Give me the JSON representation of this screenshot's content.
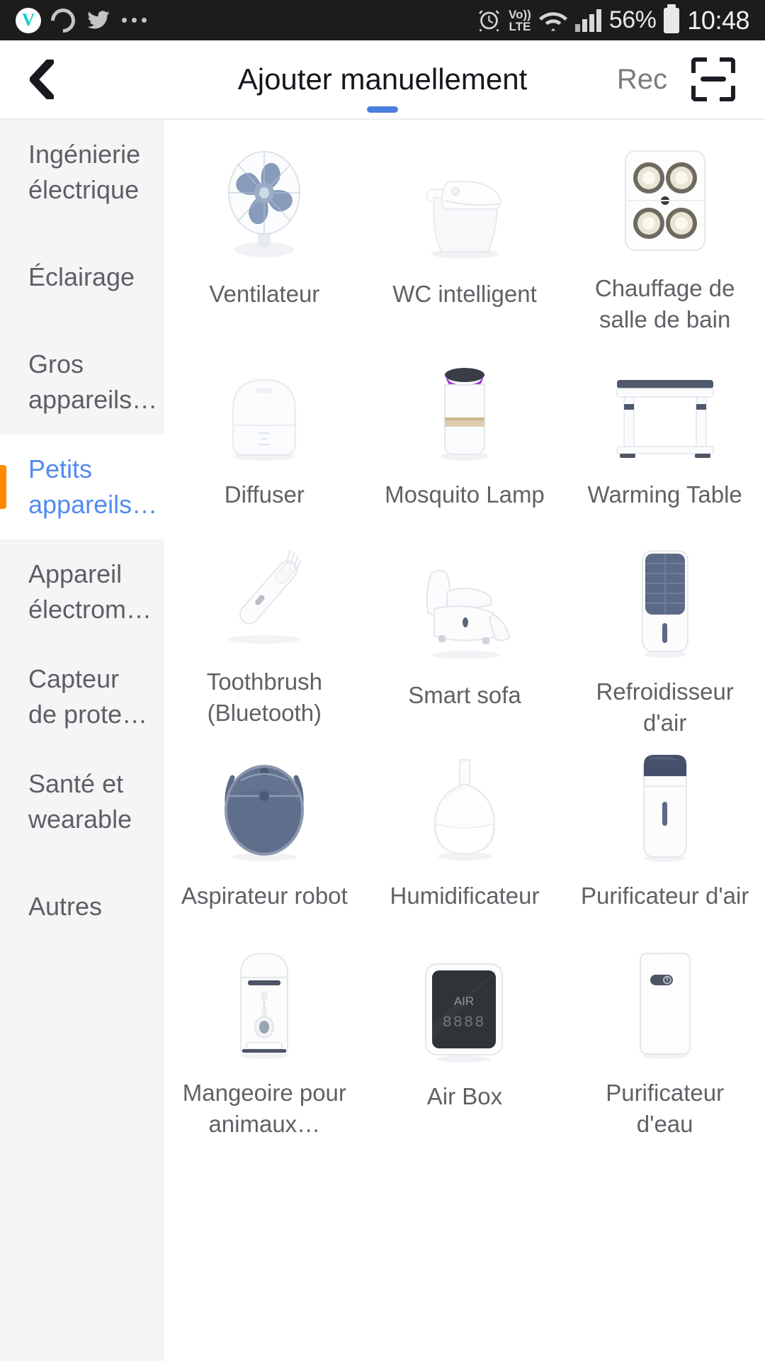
{
  "statusbar": {
    "left_icons": [
      "vivino-logo-icon",
      "ring-icon",
      "twitter-icon",
      "overflow-dots-icon"
    ],
    "vivino_letter": "V",
    "alarm_icon": "alarm-icon",
    "volte_line1": "Vo))",
    "volte_line2": "LTE",
    "wifi_icon": "wifi-icon",
    "signal_icon": "cellular-signal-icon",
    "battery_percent": "56%",
    "battery_icon": "battery-icon",
    "time": "10:48"
  },
  "appbar": {
    "back_icon": "back-chevron-icon",
    "title": "Ajouter manuellement",
    "rec_label": "Rec",
    "scan_icon": "scan-qr-icon"
  },
  "sidebar": {
    "items": [
      {
        "label": "Ingénierie électrique",
        "selected": false
      },
      {
        "label": "Éclairage",
        "selected": false
      },
      {
        "label": "Gros appareils…",
        "selected": false
      },
      {
        "label": "Petits appareils…",
        "selected": true
      },
      {
        "label": "Appareil électrom…",
        "selected": false
      },
      {
        "label": "Capteur de prote…",
        "selected": false
      },
      {
        "label": "Santé et wearable",
        "selected": false
      },
      {
        "label": "Autres",
        "selected": false
      }
    ],
    "accent_color": "#ff8a00",
    "selected_color": "#528bf0"
  },
  "grid": {
    "items": [
      {
        "label": "Ventilateur",
        "art": "fan"
      },
      {
        "label": "WC intelligent",
        "art": "toilet"
      },
      {
        "label": "Chauffage de salle de bain",
        "art": "bath-heater"
      },
      {
        "label": "Diffuser",
        "art": "diffuser"
      },
      {
        "label": "Mosquito Lamp",
        "art": "mosquito-lamp"
      },
      {
        "label": "Warming Table",
        "art": "warming-table"
      },
      {
        "label": "Toothbrush (Bluetooth)",
        "art": "toothbrush"
      },
      {
        "label": "Smart sofa",
        "art": "sofa"
      },
      {
        "label": "Refroidisseur d'air",
        "art": "air-cooler"
      },
      {
        "label": "Aspirateur robot",
        "art": "robot-vacuum"
      },
      {
        "label": "Humidificateur",
        "art": "humidifier"
      },
      {
        "label": "Purificateur d'air",
        "art": "air-purifier"
      },
      {
        "label": "Mangeoire pour animaux…",
        "art": "pet-feeder"
      },
      {
        "label": "Air Box",
        "art": "air-box"
      },
      {
        "label": "Purificateur d'eau",
        "art": "water-purifier"
      }
    ],
    "air_box_screen_label": "AIR",
    "air_box_screen_value": "8888"
  }
}
